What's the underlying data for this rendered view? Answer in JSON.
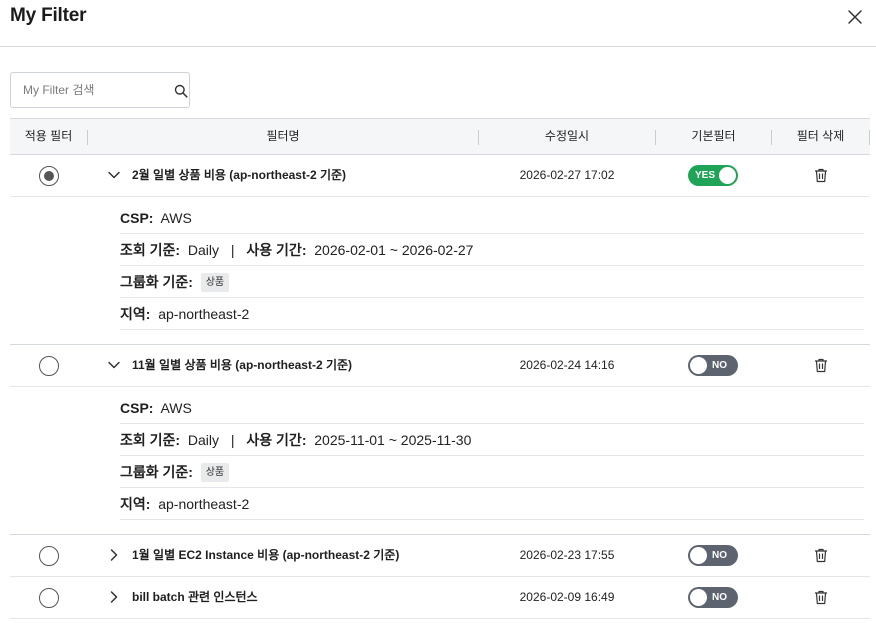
{
  "dialog": {
    "title": "My Filter"
  },
  "search": {
    "placeholder": "My Filter 검색"
  },
  "table": {
    "headers": [
      "적용 필터",
      "필터명",
      "수정일시",
      "기본필터",
      "필터 삭제"
    ],
    "rows": [
      {
        "selected": true,
        "expanded": true,
        "name": "2월 일별 상품 비용 (ap-northeast-2 기준)",
        "modified": "2026-02-27 17:02",
        "default_label": "YES",
        "default_on": true,
        "details": {
          "csp_label": "CSP:",
          "csp_value": "AWS",
          "query_label": "조회 기준:",
          "query_value": "Daily",
          "separator": "|",
          "period_label": "사용 기간:",
          "period_value": "2026-02-01 ~ 2026-02-27",
          "group_label": "그룹화 기준:",
          "group_badge": "상품",
          "region_label": "지역:",
          "region_value": "ap-northeast-2"
        }
      },
      {
        "selected": false,
        "expanded": true,
        "name": "11월 일별 상품 비용 (ap-northeast-2 기준)",
        "modified": "2026-02-24 14:16",
        "default_label": "NO",
        "default_on": false,
        "details": {
          "csp_label": "CSP:",
          "csp_value": "AWS",
          "query_label": "조회 기준:",
          "query_value": "Daily",
          "separator": "|",
          "period_label": "사용 기간:",
          "period_value": "2025-11-01 ~ 2025-11-30",
          "group_label": "그룹화 기준:",
          "group_badge": "상품",
          "region_label": "지역:",
          "region_value": "ap-northeast-2"
        }
      },
      {
        "selected": false,
        "expanded": false,
        "name": "1월 일별 EC2 Instance 비용 (ap-northeast-2 기준)",
        "modified": "2026-02-23 17:55",
        "default_label": "NO",
        "default_on": false
      },
      {
        "selected": false,
        "expanded": false,
        "name": "bill batch 관련 인스턴스",
        "modified": "2026-02-09 16:49",
        "default_label": "NO",
        "default_on": false
      }
    ]
  },
  "icons": {
    "close": "close-icon",
    "search": "search-icon",
    "expand": "chevron-down-icon",
    "collapse": "chevron-right-icon",
    "delete": "trash-icon"
  },
  "colors": {
    "toggle_on": "#1fa356",
    "toggle_off": "#5d6470"
  }
}
